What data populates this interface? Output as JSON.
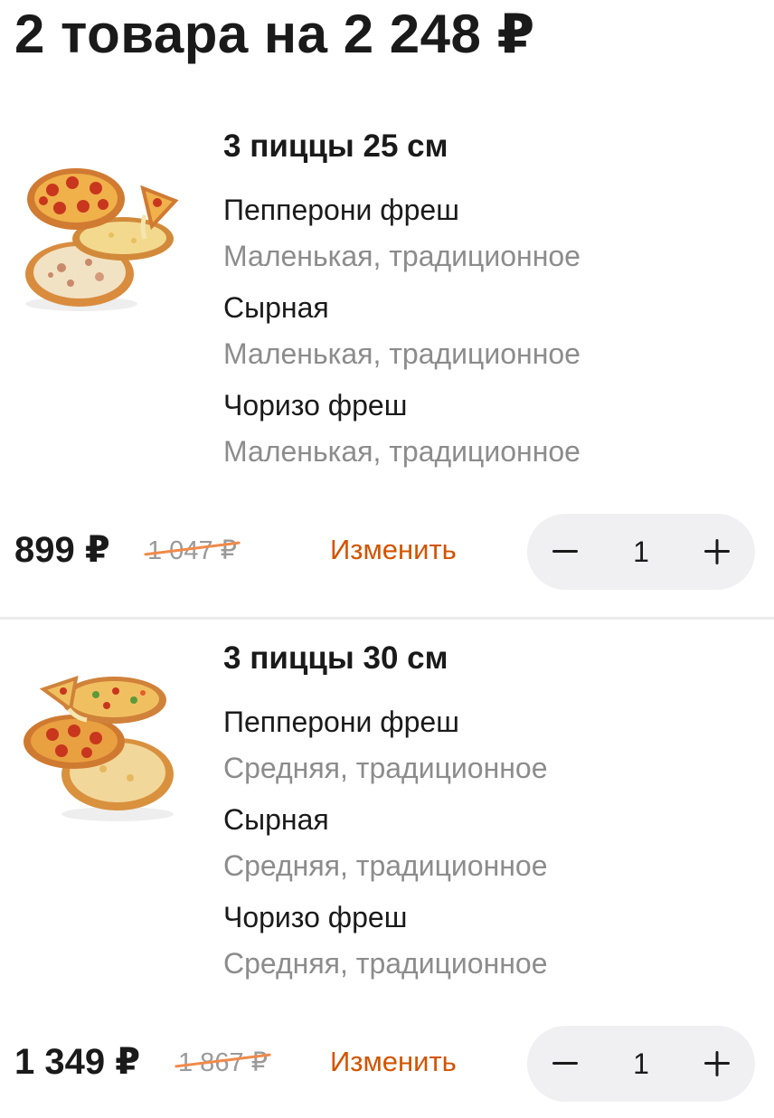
{
  "cart": {
    "title": "2 товара на 2 248 ₽"
  },
  "items": [
    {
      "name": "3 пиццы 25 см",
      "pizzas": [
        {
          "name": "Пепперони фреш",
          "details": "Маленькая, традиционное"
        },
        {
          "name": "Сырная",
          "details": "Маленькая, традиционное"
        },
        {
          "name": "Чоризо фреш",
          "details": "Маленькая, традиционное"
        }
      ],
      "price": "899 ₽",
      "old_price": "1 047 ₽",
      "edit_label": "Изменить",
      "quantity": "1"
    },
    {
      "name": "3 пиццы 30 см",
      "pizzas": [
        {
          "name": "Пепперони фреш",
          "details": "Средняя, традиционное"
        },
        {
          "name": "Сырная",
          "details": "Средняя, традиционное"
        },
        {
          "name": "Чоризо фреш",
          "details": "Средняя, традиционное"
        }
      ],
      "price": "1 349 ₽",
      "old_price": "1 867 ₽",
      "edit_label": "Изменить",
      "quantity": "1"
    }
  ],
  "colors": {
    "accent": "#d35400",
    "strike": "#f08a4b",
    "muted_text": "#8c8c8c",
    "stepper_bg": "#f0f0f2"
  },
  "icons": {
    "product_image": "pizza-combo-image",
    "decrease": "minus-icon",
    "increase": "plus-icon"
  }
}
